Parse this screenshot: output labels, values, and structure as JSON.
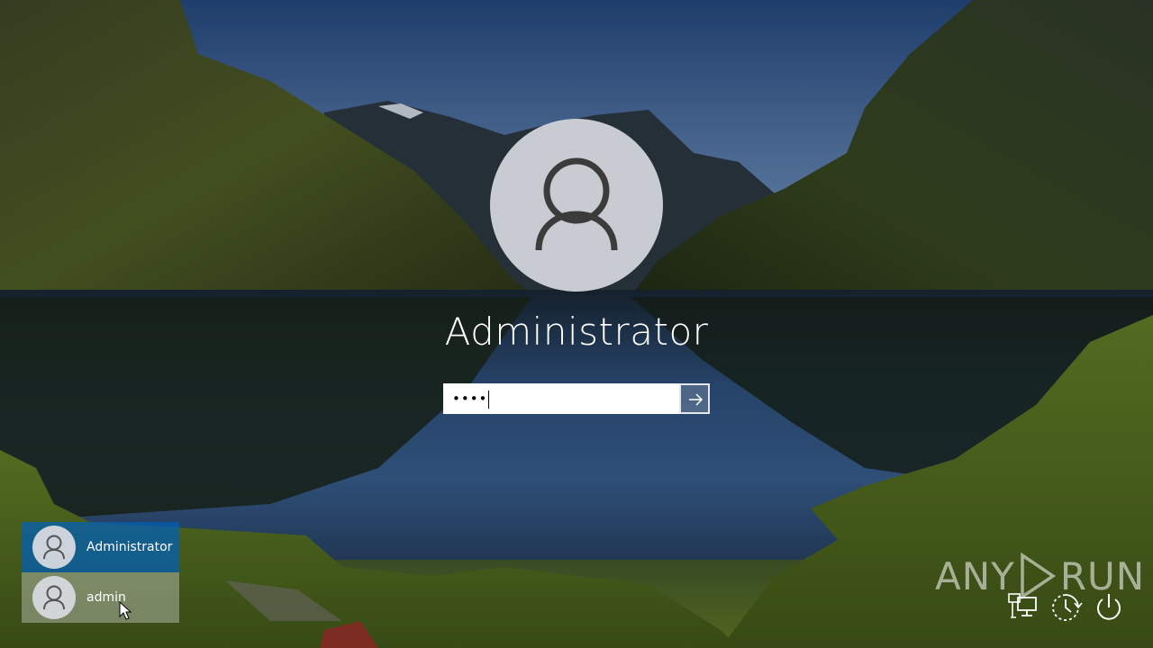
{
  "login": {
    "user_name": "Administrator",
    "password_masked": "••••"
  },
  "user_list": [
    {
      "label": "Administrator",
      "selected": true
    },
    {
      "label": "admin",
      "selected": false
    }
  ],
  "watermark": {
    "left_text": "ANY",
    "right_text": "RUN"
  },
  "icons": {
    "avatar": "user-silhouette-icon",
    "submit": "arrow-right-icon",
    "network": "network-icon",
    "ease_of_access": "ease-of-access-icon",
    "power": "power-icon"
  },
  "colors": {
    "selected_tile": "#005fb8",
    "text": "#ffffff"
  }
}
